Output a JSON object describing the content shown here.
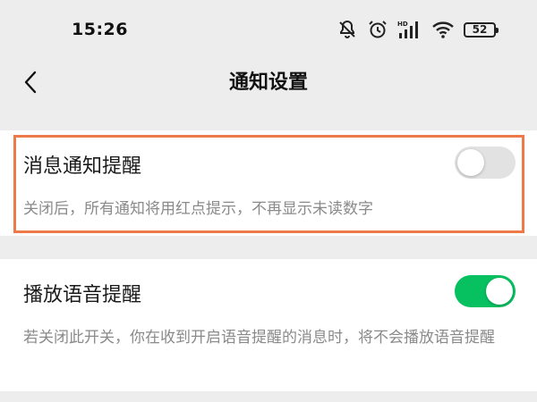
{
  "status_bar": {
    "time": "15:26",
    "hd_label": "HD",
    "battery_level": "52",
    "icons": [
      "mute-icon",
      "alarm-icon",
      "signal-icon",
      "wifi-icon",
      "battery-icon"
    ]
  },
  "nav": {
    "title": "通知设置",
    "back_icon": "chevron-left-icon"
  },
  "settings": [
    {
      "title": "消息通知提醒",
      "description": "关闭后，所有通知将用红点提示，不再显示未读数字",
      "enabled": false
    },
    {
      "title": "播放语音提醒",
      "description": "若关闭此开关，你在收到开启语音提醒的消息时，将不会播放语音提醒",
      "enabled": true
    }
  ],
  "colors": {
    "background": "#ededed",
    "card": "#ffffff",
    "toggle_on": "#07c160",
    "toggle_off": "#e2e2e2",
    "highlight": "#ee7a4a",
    "secondary_text": "#8a8a8a"
  }
}
